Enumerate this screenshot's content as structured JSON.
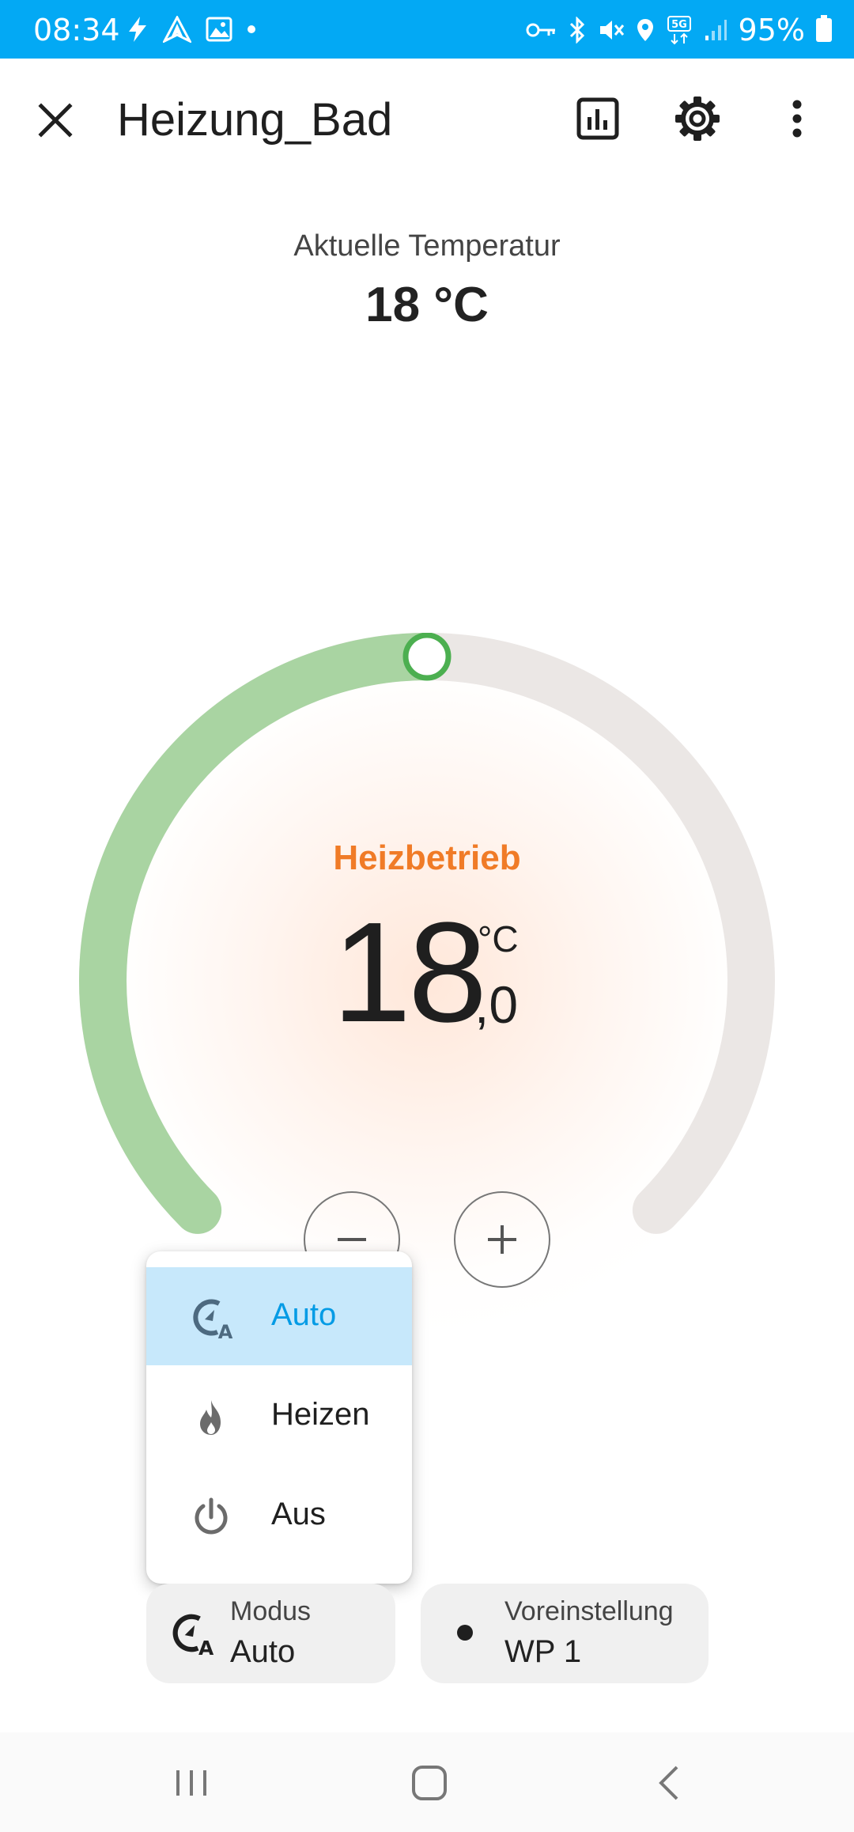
{
  "status_bar": {
    "time": "08:34",
    "battery_text": "95%",
    "network_badge": "5G",
    "left_icons": [
      "flash-icon",
      "navigation-icon",
      "image-icon",
      "dot-icon"
    ],
    "right_icons": [
      "vpn-key-icon",
      "bluetooth-icon",
      "mute-icon",
      "location-icon",
      "5g-icon",
      "signal-icon",
      "battery-icon"
    ]
  },
  "header": {
    "title": "Heizung_Bad",
    "actions": [
      "history-chart-icon",
      "settings-gear-icon",
      "more-vert-icon"
    ]
  },
  "current": {
    "label": "Aktuelle Temperatur",
    "value": "18 °C"
  },
  "thermostat": {
    "mode_label": "Heizbetrieb",
    "target_int": "18",
    "target_unit": "°C",
    "target_dec": ",0",
    "fill_fraction": 0.5,
    "colors": {
      "arc_active": "#a9d4a2",
      "arc_inactive": "#ebe7e5",
      "handle": "#4caf50",
      "mode_text": "#f07b27"
    }
  },
  "menu": {
    "items": [
      {
        "label": "Auto",
        "icon": "thermostat-auto-icon",
        "selected": true
      },
      {
        "label": "Heizen",
        "icon": "fire-icon",
        "selected": false
      },
      {
        "label": "Aus",
        "icon": "power-icon",
        "selected": false
      }
    ]
  },
  "chips": {
    "mode": {
      "label": "Modus",
      "value": "Auto",
      "icon": "thermostat-auto-icon"
    },
    "preset": {
      "label": "Voreinstellung",
      "value": "WP 1",
      "icon": "dot-icon"
    }
  },
  "nav": [
    "recents-icon",
    "home-icon",
    "back-icon"
  ],
  "colors": {
    "status_bar": "#03a9f4",
    "selected_bg": "#c7e8fb",
    "selected_text": "#039be5"
  }
}
